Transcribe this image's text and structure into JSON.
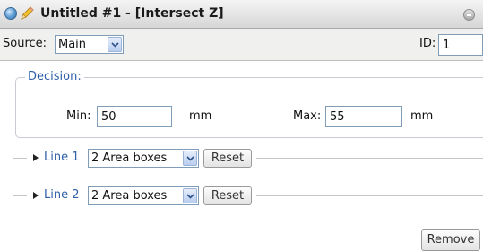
{
  "window": {
    "title": "Untitled #1 - [Intersect Z]",
    "icons": [
      "sphere-icon",
      "pencil-icon",
      "minimize-icon"
    ]
  },
  "toolbar": {
    "source_label": "Source:",
    "source_value": "Main",
    "id_label": "ID:",
    "id_value": "1"
  },
  "decision": {
    "legend": "Decision:",
    "min_label": "Min:",
    "min_value": "50",
    "min_unit": "mm",
    "max_label": "Max:",
    "max_value": "55",
    "max_unit": "mm"
  },
  "lines": [
    {
      "label": "Line 1",
      "mode": "2 Area boxes",
      "reset_label": "Reset"
    },
    {
      "label": "Line 2",
      "mode": "2 Area boxes",
      "reset_label": "Reset"
    }
  ],
  "footer": {
    "remove_label": "Remove"
  },
  "colors": {
    "link_blue": "#2f5fa8",
    "border_blue": "#7f9db9"
  }
}
